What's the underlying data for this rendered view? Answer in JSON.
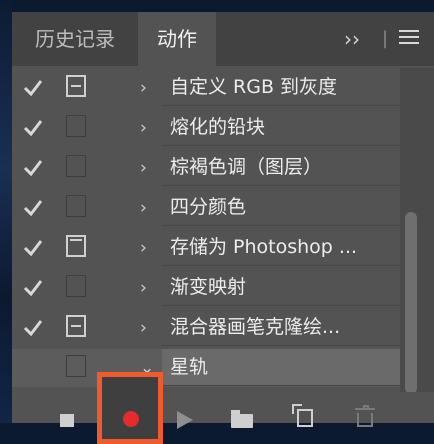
{
  "tabs": [
    {
      "label": "历史记录",
      "active": false
    },
    {
      "label": "动作",
      "active": true
    }
  ],
  "tab_controls": {
    "more_label": "››",
    "separator": "|",
    "menu_icon": "hamburger-menu-icon"
  },
  "actions": [
    {
      "name": "自定义 RGB 到灰度",
      "checked": true,
      "dialog": "minus",
      "expanded": false
    },
    {
      "name": "熔化的铅块",
      "checked": true,
      "dialog": "none",
      "expanded": false
    },
    {
      "name": "棕褐色调（图层）",
      "checked": true,
      "dialog": "none",
      "expanded": false
    },
    {
      "name": "四分颜色",
      "checked": true,
      "dialog": "none",
      "expanded": false
    },
    {
      "name": "存储为 Photoshop ...",
      "checked": true,
      "dialog": "plain",
      "expanded": false
    },
    {
      "name": "渐变映射",
      "checked": true,
      "dialog": "none",
      "expanded": false
    },
    {
      "name": "混合器画笔克隆绘...",
      "checked": true,
      "dialog": "minus",
      "expanded": false
    },
    {
      "name": "星轨",
      "checked": false,
      "dialog": "none",
      "expanded": true,
      "selected": true
    }
  ],
  "toolbar": {
    "stop_icon": "stop-icon",
    "record_icon": "record-icon",
    "play_icon": "play-icon",
    "new_set_icon": "folder-icon",
    "new_action_icon": "new-action-icon",
    "delete_icon": "trash-icon"
  },
  "colors": {
    "panel": "#535353",
    "tabbar": "#424242",
    "record_highlight": "#ef5b2f",
    "record_dot": "#e32d2d"
  }
}
